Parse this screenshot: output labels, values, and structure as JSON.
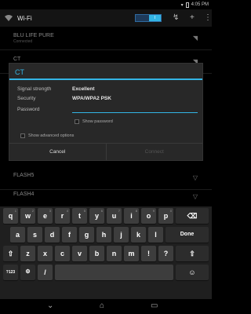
{
  "status_bar": {
    "time": "4:05 PM"
  },
  "action_bar": {
    "title": "Wi-Fi",
    "toggle_label": "I"
  },
  "networks": [
    {
      "name": "BLU LIFE PURE",
      "status": "Connected"
    },
    {
      "name": "CT",
      "status": ""
    },
    {
      "name": "FLASH5",
      "status": ""
    },
    {
      "name": "FLASH4",
      "status": ""
    }
  ],
  "dialog": {
    "title": "CT",
    "signal_label": "Signal strength",
    "signal_value": "Excellent",
    "security_label": "Security",
    "security_value": "WPA/WPA2 PSK",
    "password_label": "Password",
    "password_value": "",
    "show_password_label": "Show password",
    "advanced_label": "Show advanced options",
    "cancel_label": "Cancel",
    "connect_label": "Connect"
  },
  "keyboard": {
    "row1": [
      "q",
      "w",
      "e",
      "r",
      "t",
      "y",
      "u",
      "i",
      "o",
      "p"
    ],
    "row1_hints": [
      "1",
      "2",
      "3",
      "4",
      "5",
      "6",
      "7",
      "8",
      "9",
      "0"
    ],
    "row2": [
      "a",
      "s",
      "d",
      "f",
      "g",
      "h",
      "j",
      "k",
      "l"
    ],
    "done_label": "Done",
    "row3": [
      "z",
      "x",
      "c",
      "v",
      "b",
      "n",
      "m",
      "!",
      "?"
    ],
    "symbols_label": "?123",
    "emoji_label": "☺",
    "slash_label": "/"
  },
  "icons": {
    "wifi": "wifi-icon",
    "add": "add-icon",
    "menu": "overflow-menu-icon",
    "backspace": "backspace-icon",
    "shift": "shift-icon",
    "back": "back-icon",
    "home": "home-icon",
    "recents": "recents-icon"
  }
}
